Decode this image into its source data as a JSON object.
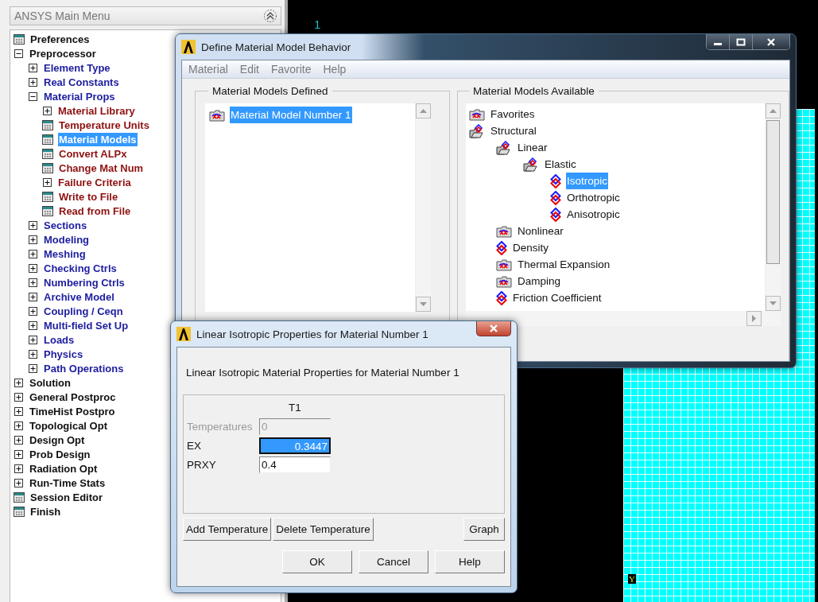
{
  "main_menu": {
    "title": "ANSYS Main Menu",
    "items": [
      {
        "label": "Preferences",
        "kind": "command",
        "selected": false
      },
      {
        "label": "Preprocessor",
        "kind": "folder",
        "expanded": true,
        "selected": false,
        "children": [
          {
            "label": "Element Type",
            "kind": "folder",
            "expanded": false,
            "selected": false
          },
          {
            "label": "Real Constants",
            "kind": "folder",
            "expanded": false,
            "selected": false
          },
          {
            "label": "Material Props",
            "kind": "folder",
            "expanded": true,
            "selected": false,
            "children": [
              {
                "label": "Material Library",
                "kind": "folder",
                "expanded": false,
                "selected": false
              },
              {
                "label": "Temperature Units",
                "kind": "command",
                "selected": false
              },
              {
                "label": "Material Models",
                "kind": "command",
                "selected": true
              },
              {
                "label": "Convert ALPx",
                "kind": "command",
                "selected": false
              },
              {
                "label": "Change Mat Num",
                "kind": "command",
                "selected": false
              },
              {
                "label": "Failure Criteria",
                "kind": "folder",
                "expanded": false,
                "selected": false
              },
              {
                "label": "Write to File",
                "kind": "command",
                "selected": false
              },
              {
                "label": "Read from File",
                "kind": "command",
                "selected": false
              }
            ]
          },
          {
            "label": "Sections",
            "kind": "folder",
            "expanded": false,
            "selected": false
          },
          {
            "label": "Modeling",
            "kind": "folder",
            "expanded": false,
            "selected": false
          },
          {
            "label": "Meshing",
            "kind": "folder",
            "expanded": false,
            "selected": false
          },
          {
            "label": "Checking Ctrls",
            "kind": "folder",
            "expanded": false,
            "selected": false
          },
          {
            "label": "Numbering Ctrls",
            "kind": "folder",
            "expanded": false,
            "selected": false
          },
          {
            "label": "Archive Model",
            "kind": "folder",
            "expanded": false,
            "selected": false
          },
          {
            "label": "Coupling / Ceqn",
            "kind": "folder",
            "expanded": false,
            "selected": false
          },
          {
            "label": "Multi-field Set Up",
            "kind": "folder",
            "expanded": false,
            "selected": false
          },
          {
            "label": "Loads",
            "kind": "folder",
            "expanded": false,
            "selected": false
          },
          {
            "label": "Physics",
            "kind": "folder",
            "expanded": false,
            "selected": false
          },
          {
            "label": "Path Operations",
            "kind": "folder",
            "expanded": false,
            "selected": false
          }
        ]
      },
      {
        "label": "Solution",
        "kind": "folder",
        "expanded": false,
        "selected": false
      },
      {
        "label": "General Postproc",
        "kind": "folder",
        "expanded": false,
        "selected": false
      },
      {
        "label": "TimeHist Postpro",
        "kind": "folder",
        "expanded": false,
        "selected": false
      },
      {
        "label": "Topological Opt",
        "kind": "folder",
        "expanded": false,
        "selected": false
      },
      {
        "label": "Design Opt",
        "kind": "folder",
        "expanded": false,
        "selected": false
      },
      {
        "label": "Prob Design",
        "kind": "folder",
        "expanded": false,
        "selected": false
      },
      {
        "label": "Radiation Opt",
        "kind": "folder",
        "expanded": false,
        "selected": false
      },
      {
        "label": "Run-Time Stats",
        "kind": "folder",
        "expanded": false,
        "selected": false
      },
      {
        "label": "Session Editor",
        "kind": "command",
        "selected": false
      },
      {
        "label": "Finish",
        "kind": "command",
        "selected": false
      }
    ]
  },
  "graphics": {
    "window_number": "1",
    "axis_label": "Y"
  },
  "material_window": {
    "title": "Define Material Model Behavior",
    "menu": [
      "Material",
      "Edit",
      "Favorite",
      "Help"
    ],
    "defined": {
      "title": "Material Models Defined",
      "items": [
        {
          "label": "Material Model Number 1",
          "selected": true
        }
      ]
    },
    "available": {
      "title": "Material Models Available",
      "items": [
        {
          "label": "Favorites",
          "kind": "folder",
          "expanded": false,
          "selected": false
        },
        {
          "label": "Structural",
          "kind": "folder",
          "expanded": true,
          "selected": false,
          "children": [
            {
              "label": "Linear",
              "kind": "folder",
              "expanded": true,
              "selected": false,
              "children": [
                {
                  "label": "Elastic",
                  "kind": "folder",
                  "expanded": true,
                  "selected": false,
                  "children": [
                    {
                      "label": "Isotropic",
                      "kind": "model",
                      "selected": true
                    },
                    {
                      "label": "Orthotropic",
                      "kind": "model",
                      "selected": false
                    },
                    {
                      "label": "Anisotropic",
                      "kind": "model",
                      "selected": false
                    }
                  ]
                }
              ]
            },
            {
              "label": "Nonlinear",
              "kind": "folder",
              "expanded": false,
              "selected": false
            },
            {
              "label": "Density",
              "kind": "model",
              "selected": false
            },
            {
              "label": "Thermal Expansion",
              "kind": "folder",
              "expanded": false,
              "selected": false
            },
            {
              "label": "Damping",
              "kind": "folder",
              "expanded": false,
              "selected": false
            },
            {
              "label": "Friction Coefficient",
              "kind": "model",
              "selected": false
            }
          ]
        }
      ]
    }
  },
  "properties_dialog": {
    "title": "Linear Isotropic Properties for Material Number 1",
    "caption": "Linear Isotropic Material Properties for Material Number 1",
    "column": "T1",
    "rows": [
      {
        "label": "Temperatures",
        "value": "0",
        "disabled": true,
        "selected": false
      },
      {
        "label": "EX",
        "value": "0.3447",
        "disabled": false,
        "selected": true
      },
      {
        "label": "PRXY",
        "value": "0.4",
        "disabled": false,
        "selected": false
      }
    ],
    "table_buttons": [
      "Add Temperature",
      "Delete Temperature",
      "Graph"
    ],
    "buttons": [
      "OK",
      "Cancel",
      "Help"
    ]
  }
}
